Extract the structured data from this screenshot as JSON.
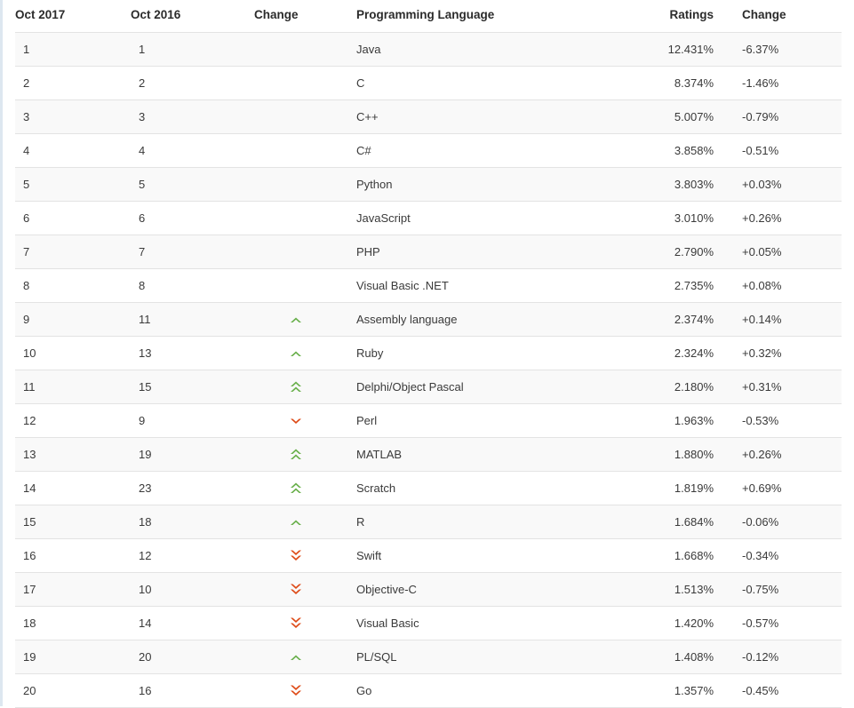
{
  "table": {
    "columns": [
      {
        "key": "rank_new",
        "label": "Oct 2017"
      },
      {
        "key": "rank_old",
        "label": "Oct 2016"
      },
      {
        "key": "change",
        "label": "Change"
      },
      {
        "key": "language",
        "label": "Programming Language"
      },
      {
        "key": "ratings",
        "label": "Ratings"
      },
      {
        "key": "delta",
        "label": "Change"
      }
    ],
    "colors": {
      "up_arrow": "#6ab04c",
      "down_arrow": "#dd4814",
      "row_stripe": "#f9f9f9",
      "row_border": "#e3e3e3",
      "text": "#3a3a3a",
      "header_text": "#2b2b2b"
    },
    "rows": [
      {
        "rank_new": "1",
        "rank_old": "1",
        "change": "none",
        "change_icon": "",
        "language": "Java",
        "ratings": "12.431%",
        "delta": "-6.37%"
      },
      {
        "rank_new": "2",
        "rank_old": "2",
        "change": "none",
        "change_icon": "",
        "language": "C",
        "ratings": "8.374%",
        "delta": "-1.46%"
      },
      {
        "rank_new": "3",
        "rank_old": "3",
        "change": "none",
        "change_icon": "",
        "language": "C++",
        "ratings": "5.007%",
        "delta": "-0.79%"
      },
      {
        "rank_new": "4",
        "rank_old": "4",
        "change": "none",
        "change_icon": "",
        "language": "C#",
        "ratings": "3.858%",
        "delta": "-0.51%"
      },
      {
        "rank_new": "5",
        "rank_old": "5",
        "change": "none",
        "change_icon": "",
        "language": "Python",
        "ratings": "3.803%",
        "delta": "+0.03%"
      },
      {
        "rank_new": "6",
        "rank_old": "6",
        "change": "none",
        "change_icon": "",
        "language": "JavaScript",
        "ratings": "3.010%",
        "delta": "+0.26%"
      },
      {
        "rank_new": "7",
        "rank_old": "7",
        "change": "none",
        "change_icon": "",
        "language": "PHP",
        "ratings": "2.790%",
        "delta": "+0.05%"
      },
      {
        "rank_new": "8",
        "rank_old": "8",
        "change": "none",
        "change_icon": "",
        "language": "Visual Basic .NET",
        "ratings": "2.735%",
        "delta": "+0.08%"
      },
      {
        "rank_new": "9",
        "rank_old": "11",
        "change": "up",
        "change_icon": "chevron-up-icon",
        "language": "Assembly language",
        "ratings": "2.374%",
        "delta": "+0.14%"
      },
      {
        "rank_new": "10",
        "rank_old": "13",
        "change": "up",
        "change_icon": "chevron-up-icon",
        "language": "Ruby",
        "ratings": "2.324%",
        "delta": "+0.32%"
      },
      {
        "rank_new": "11",
        "rank_old": "15",
        "change": "up-double",
        "change_icon": "chevron-double-up-icon",
        "language": "Delphi/Object Pascal",
        "ratings": "2.180%",
        "delta": "+0.31%"
      },
      {
        "rank_new": "12",
        "rank_old": "9",
        "change": "down",
        "change_icon": "chevron-down-icon",
        "language": "Perl",
        "ratings": "1.963%",
        "delta": "-0.53%"
      },
      {
        "rank_new": "13",
        "rank_old": "19",
        "change": "up-double",
        "change_icon": "chevron-double-up-icon",
        "language": "MATLAB",
        "ratings": "1.880%",
        "delta": "+0.26%"
      },
      {
        "rank_new": "14",
        "rank_old": "23",
        "change": "up-double",
        "change_icon": "chevron-double-up-icon",
        "language": "Scratch",
        "ratings": "1.819%",
        "delta": "+0.69%"
      },
      {
        "rank_new": "15",
        "rank_old": "18",
        "change": "up",
        "change_icon": "chevron-up-icon",
        "language": "R",
        "ratings": "1.684%",
        "delta": "-0.06%"
      },
      {
        "rank_new": "16",
        "rank_old": "12",
        "change": "down-double",
        "change_icon": "chevron-double-down-icon",
        "language": "Swift",
        "ratings": "1.668%",
        "delta": "-0.34%"
      },
      {
        "rank_new": "17",
        "rank_old": "10",
        "change": "down-double",
        "change_icon": "chevron-double-down-icon",
        "language": "Objective-C",
        "ratings": "1.513%",
        "delta": "-0.75%"
      },
      {
        "rank_new": "18",
        "rank_old": "14",
        "change": "down-double",
        "change_icon": "chevron-double-down-icon",
        "language": "Visual Basic",
        "ratings": "1.420%",
        "delta": "-0.57%"
      },
      {
        "rank_new": "19",
        "rank_old": "20",
        "change": "up",
        "change_icon": "chevron-up-icon",
        "language": "PL/SQL",
        "ratings": "1.408%",
        "delta": "-0.12%"
      },
      {
        "rank_new": "20",
        "rank_old": "16",
        "change": "down-double",
        "change_icon": "chevron-double-down-icon",
        "language": "Go",
        "ratings": "1.357%",
        "delta": "-0.45%"
      }
    ]
  }
}
